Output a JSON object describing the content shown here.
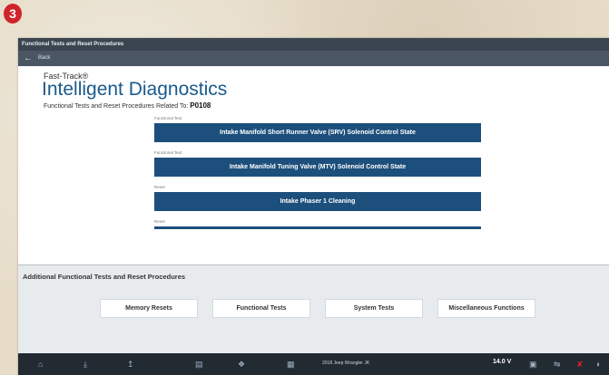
{
  "badge": "3",
  "window": {
    "title": "Functional Tests and Reset Procedures",
    "back_label": "Back"
  },
  "header": {
    "brand_small": "Fast-Track®",
    "brand_large": "Intelligent Diagnostics",
    "related_label": "Functional Tests and Reset Procedures Related To:",
    "code": "P0108"
  },
  "procedures": [
    {
      "type": "Functional Test",
      "label": "Intake Manifold Short Runner Valve (SRV) Solenoid Control State"
    },
    {
      "type": "Functional Test",
      "label": "Intake Manifold Tuning Valve (MTV) Solenoid Control State"
    },
    {
      "type": "Reset",
      "label": "Intake Phaser 1 Cleaning"
    },
    {
      "type": "Reset",
      "label": ""
    }
  ],
  "additional": {
    "title": "Additional Functional Tests and Reset Procedures",
    "buttons": [
      "Memory Resets",
      "Functional Tests",
      "System Tests",
      "Miscellaneous Functions"
    ]
  },
  "taskbar": {
    "vehicle": "2018 Jeep Wrangler JK",
    "voltage": "14.0 V",
    "icons": [
      "home-icon",
      "download-icon",
      "upload-icon",
      "scanner-icon",
      "tools-icon",
      "calendar-icon",
      "battery-icon",
      "connection-icon",
      "signal-icon",
      "gauge-icon"
    ],
    "accent": "#d0242b"
  }
}
